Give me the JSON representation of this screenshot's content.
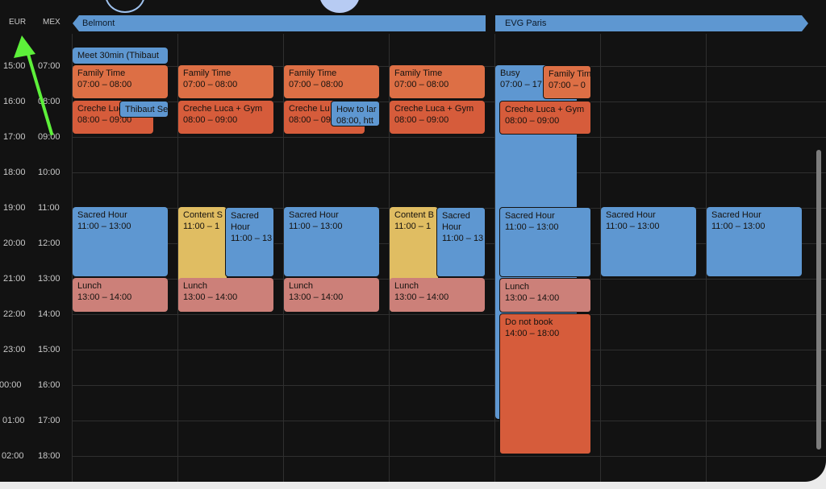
{
  "timezones": {
    "primary": "EUR",
    "secondary": "MEX"
  },
  "times_eur": [
    "15:00",
    "16:00",
    "17:00",
    "18:00",
    "19:00",
    "20:00",
    "21:00",
    "22:00",
    "23:00",
    "00:00",
    "01:00",
    "02:00"
  ],
  "times_mex": [
    "07:00",
    "08:00",
    "09:00",
    "10:00",
    "11:00",
    "12:00",
    "13:00",
    "14:00",
    "15:00",
    "16:00",
    "17:00",
    "18:00"
  ],
  "banners": {
    "belmont": "Belmont",
    "evg": "EVG Paris"
  },
  "events": {
    "meet": {
      "title": "Meet 30min (Thibaut"
    },
    "d1": {
      "family": {
        "title": "Family Time",
        "time": "07:00 – 08:00"
      },
      "creche": {
        "title": "Creche Luca",
        "time": "08:00 – 09:00"
      },
      "thibaut": {
        "title": "Thibaut Se"
      },
      "sacred": {
        "title": "Sacred Hour",
        "time": "11:00 – 13:00"
      },
      "lunch": {
        "title": "Lunch",
        "time": "13:00 – 14:00"
      }
    },
    "d2": {
      "family": {
        "title": "Family Time",
        "time": "07:00 – 08:00"
      },
      "creche": {
        "title": "Creche Luca + Gym",
        "time": "08:00 – 09:00"
      },
      "content": {
        "title": "Content S",
        "time": "11:00 – 1"
      },
      "sacred": {
        "title": "Sacred Hour",
        "time": "11:00 – 13"
      },
      "lunch": {
        "title": "Lunch",
        "time": "13:00 – 14:00"
      }
    },
    "d3": {
      "family": {
        "title": "Family Time",
        "time": "07:00 – 08:00"
      },
      "creche": {
        "title": "Creche Lu",
        "time": "08:00 – 09"
      },
      "howto": {
        "title": "How to lar",
        "time": "08:00, htt"
      },
      "sacred": {
        "title": "Sacred Hour",
        "time": "11:00 – 13:00"
      },
      "lunch": {
        "title": "Lunch",
        "time": "13:00 – 14:00"
      }
    },
    "d4": {
      "family": {
        "title": "Family Time",
        "time": "07:00 – 08:00"
      },
      "creche": {
        "title": "Creche Luca + Gym",
        "time": "08:00 – 09:00"
      },
      "content": {
        "title": "Content B",
        "time": "11:00 – 1"
      },
      "sacred": {
        "title": "Sacred Hour",
        "time": "11:00 – 13"
      },
      "lunch": {
        "title": "Lunch",
        "time": "13:00 – 14:00"
      }
    },
    "d5": {
      "busy": {
        "title": "Busy",
        "time": "07:00 – 17"
      },
      "family": {
        "title": "Family Tim",
        "time": "07:00 – 0"
      },
      "creche": {
        "title": "Creche Luca + Gym",
        "time": "08:00 – 09:00"
      },
      "sacred": {
        "title": "Sacred Hour",
        "time": "11:00 – 13:00"
      },
      "lunch": {
        "title": "Lunch",
        "time": "13:00 – 14:00"
      },
      "donotbook": {
        "title": "Do not book",
        "time": "14:00 – 18:00"
      }
    },
    "d6": {
      "sacred": {
        "title": "Sacred Hour",
        "time": "11:00 – 13:00"
      }
    },
    "d7": {
      "sacred": {
        "title": "Sacred Hour",
        "time": "11:00 – 13:00"
      }
    }
  },
  "colors": {
    "blue": "#5e97d1",
    "orange": "#dd6f45",
    "rust": "#d65c3b",
    "salmon": "#cc8079",
    "yellow": "#e0bd62",
    "arrow": "#5df03a"
  }
}
